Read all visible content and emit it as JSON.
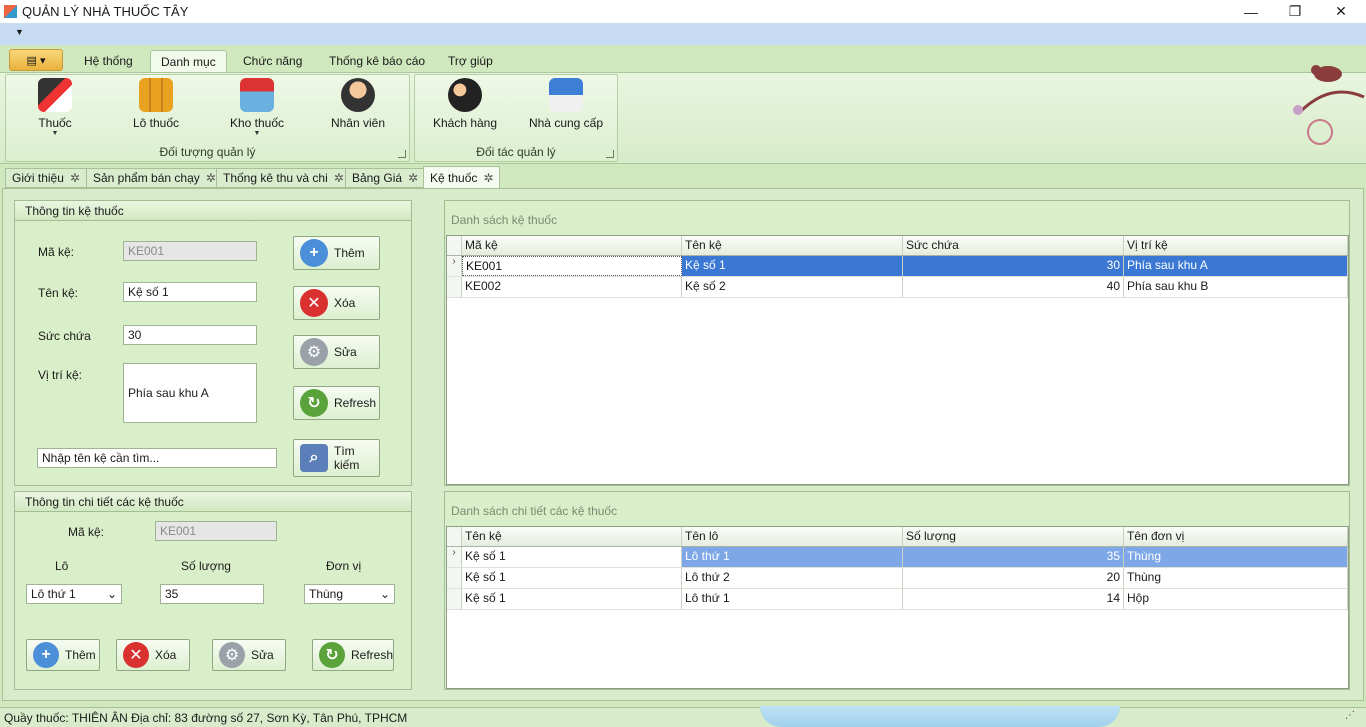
{
  "window": {
    "title": "QUẢN LÝ NHÀ THUỐC TÂY",
    "minimize": "—",
    "restore": "❐",
    "close": "✕"
  },
  "ribbon": {
    "tabs": [
      {
        "label": "Hệ thống"
      },
      {
        "label": "Danh mục"
      },
      {
        "label": "Chức năng"
      },
      {
        "label": "Thống kê báo cáo"
      },
      {
        "label": "Trợ giúp"
      }
    ],
    "groups": [
      {
        "label": "Đối tượng quản lý",
        "buttons": [
          {
            "label": "Thuốc",
            "icon": "medicine-capsule-icon"
          },
          {
            "label": "Lô thuốc",
            "icon": "boxes-icon"
          },
          {
            "label": "Kho thuốc",
            "icon": "store-icon"
          },
          {
            "label": "Nhân viên",
            "icon": "person-icon"
          }
        ]
      },
      {
        "label": "Đối tác quản lý",
        "buttons": [
          {
            "label": "Khách hàng",
            "icon": "customers-icon"
          },
          {
            "label": "Nhà cung cấp",
            "icon": "delivery-icon"
          }
        ]
      }
    ]
  },
  "doc_tabs": [
    {
      "label": "Giới thiệu"
    },
    {
      "label": "Sản phẩm bán chạy"
    },
    {
      "label": "Thống kê thu và chi"
    },
    {
      "label": "Bảng Giá"
    },
    {
      "label": "Kệ thuốc"
    }
  ],
  "shelf_info": {
    "title": "Thông tin kệ thuốc",
    "ma_ke_label": "Mã kệ:",
    "ma_ke_value": "KE001",
    "ten_ke_label": "Tên kệ:",
    "ten_ke_value": "Kệ số 1",
    "suc_chua_label": "Sức chứa",
    "suc_chua_value": "30",
    "vi_tri_label": "Vị trí kệ:",
    "vi_tri_value": "Phía sau khu A",
    "search_placeholder": "Nhập tên kệ cần tìm...",
    "buttons": {
      "add": "Thêm",
      "delete": "Xóa",
      "edit": "Sửa",
      "refresh": "Refresh",
      "search": "Tìm kiếm"
    }
  },
  "detail_info": {
    "title": "Thông tin chi tiết các kệ thuốc",
    "ma_ke_label": "Mã kệ:",
    "ma_ke_value": "KE001",
    "lo_label": "Lô",
    "lo_value": "Lô thứ 1",
    "so_luong_label": "Số lượng",
    "so_luong_value": "35",
    "don_vi_label": "Đơn vị",
    "don_vi_value": "Thùng",
    "buttons": {
      "add": "Thêm",
      "delete": "Xóa",
      "edit": "Sửa",
      "refresh": "Refresh"
    }
  },
  "shelf_list": {
    "title": "Danh sách kệ thuốc",
    "columns": [
      "Mã kệ",
      "Tên kệ",
      "Sức chứa",
      "Vị trí kệ"
    ],
    "rows": [
      [
        "KE001",
        "Kệ số 1",
        "30",
        "Phía sau khu A"
      ],
      [
        "KE002",
        "Kệ số 2",
        "40",
        "Phía sau khu B"
      ]
    ]
  },
  "detail_list": {
    "title": "Danh sách chi tiết các kệ thuốc",
    "columns": [
      "Tên kệ",
      "Tên lô",
      "Số lượng",
      "Tên đơn vị"
    ],
    "rows": [
      [
        "Kệ số 1",
        "Lô thứ 1",
        "35",
        "Thùng"
      ],
      [
        "Kệ số 1",
        "Lô thứ 2",
        "20",
        "Thùng"
      ],
      [
        "Kệ số 1",
        "Lô thứ 1",
        "14",
        "Hộp"
      ]
    ]
  },
  "status": {
    "text": "Quầy thuốc: THIÊN ÂN  Địa chỉ: 83 đường số 27, Sơn Kỳ, Tân Phú, TPHCM"
  },
  "colors": {
    "accent_selection": "#3a78d4",
    "panel_green": "#d9efc9",
    "ribbon_bg": "#cfe8bd"
  }
}
